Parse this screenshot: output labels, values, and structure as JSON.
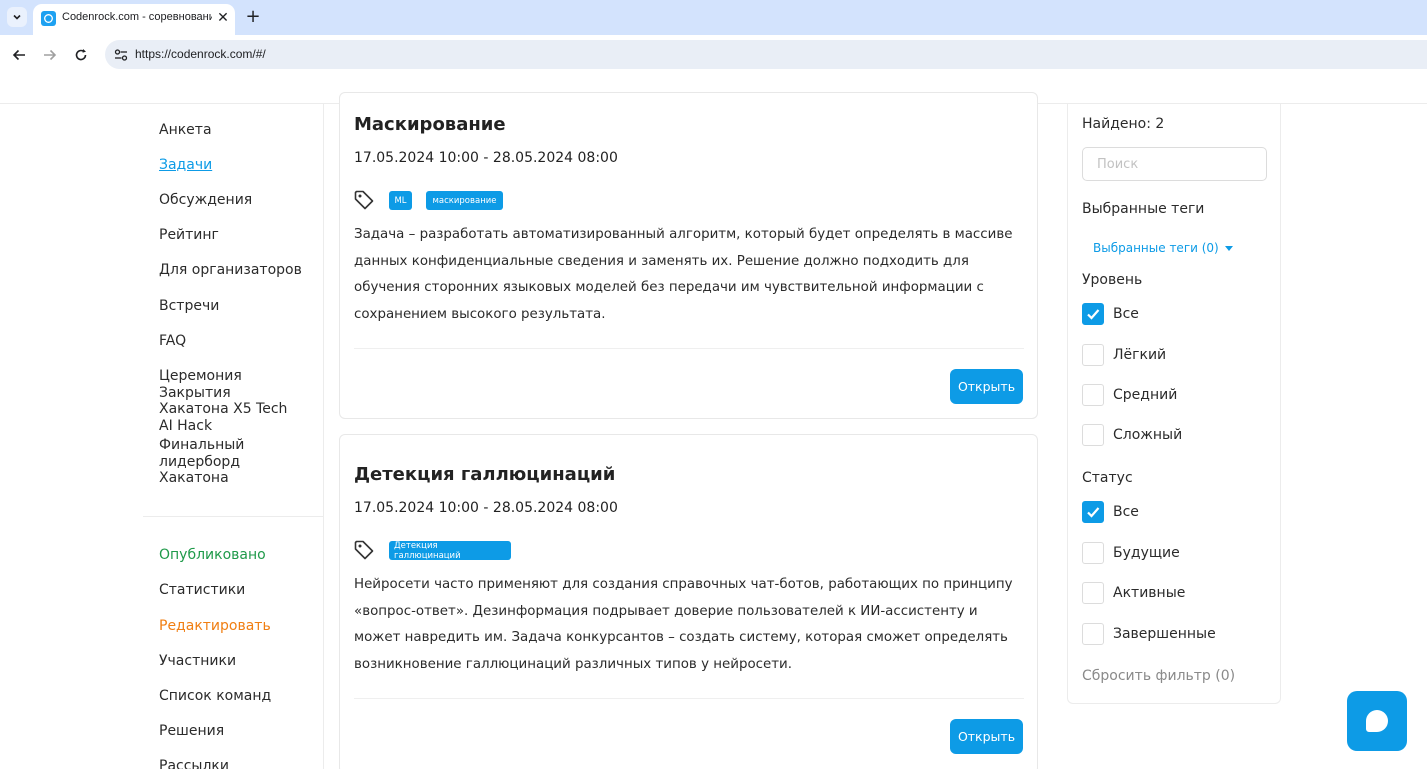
{
  "browser": {
    "tab_title": "Codenrock.com - соревнования",
    "url": "https://codenrock.com/#/"
  },
  "sidebar": {
    "items": [
      {
        "label": "Анкета"
      },
      {
        "label": "Задачи"
      },
      {
        "label": "Обсуждения"
      },
      {
        "label": "Рейтинг"
      },
      {
        "label": "Для организаторов"
      },
      {
        "label": "Встречи"
      },
      {
        "label": "FAQ"
      },
      {
        "label": "Церемония Закрытия Хакатона X5 Tech AI Hack"
      },
      {
        "label": "Финальный лидерборд Хакатона"
      }
    ],
    "admin_items": [
      {
        "label": "Опубликовано"
      },
      {
        "label": "Статистики"
      },
      {
        "label": "Редактировать"
      },
      {
        "label": "Участники"
      },
      {
        "label": "Список команд"
      },
      {
        "label": "Решения"
      },
      {
        "label": "Рассылки"
      }
    ]
  },
  "tasks": [
    {
      "title": "Маскирование",
      "dates": "17.05.2024 10:00 - 28.05.2024 08:00",
      "tags": [
        "ML",
        "маскирование"
      ],
      "description": "Задача – разработать автоматизированный алгоритм, который будет определять в массиве данных конфиденциальные сведения и заменять их. Решение должно подходить для обучения сторонних языковых моделей без передачи им чувствительной информации с сохранением высокого результата.",
      "button": "Открыть"
    },
    {
      "title": "Детекция галлюцинаций",
      "dates": "17.05.2024 10:00 - 28.05.2024 08:00",
      "tags": [
        "Детекция галлюцинаций"
      ],
      "description": "Нейросети часто применяют для создания справочных чат-ботов, работающих по принципу «вопрос-ответ». Дезинформация подрывает доверие пользователей к ИИ-ассистенту и может навредить им. Задача конкурсантов – создать систему, которая сможет определять возникновение галлюцинаций различных типов у нейросети.",
      "button": "Открыть"
    }
  ],
  "filter": {
    "found": "Найдено: 2",
    "search_placeholder": "Поиск",
    "selected_tags_label": "Выбранные теги",
    "selected_tags_dropdown": "Выбранные теги (0)",
    "level_label": "Уровень",
    "levels": [
      {
        "label": "Все",
        "checked": true
      },
      {
        "label": "Лёгкий",
        "checked": false
      },
      {
        "label": "Средний",
        "checked": false
      },
      {
        "label": "Сложный",
        "checked": false
      }
    ],
    "status_label": "Статус",
    "statuses": [
      {
        "label": "Все",
        "checked": true
      },
      {
        "label": "Будущие",
        "checked": false
      },
      {
        "label": "Активные",
        "checked": false
      },
      {
        "label": "Завершенные",
        "checked": false
      }
    ],
    "reset": "Сбросить фильтр (0)"
  },
  "colors": {
    "accent": "#0d9be6",
    "published": "#1f9a4a",
    "edit": "#f07e12"
  }
}
